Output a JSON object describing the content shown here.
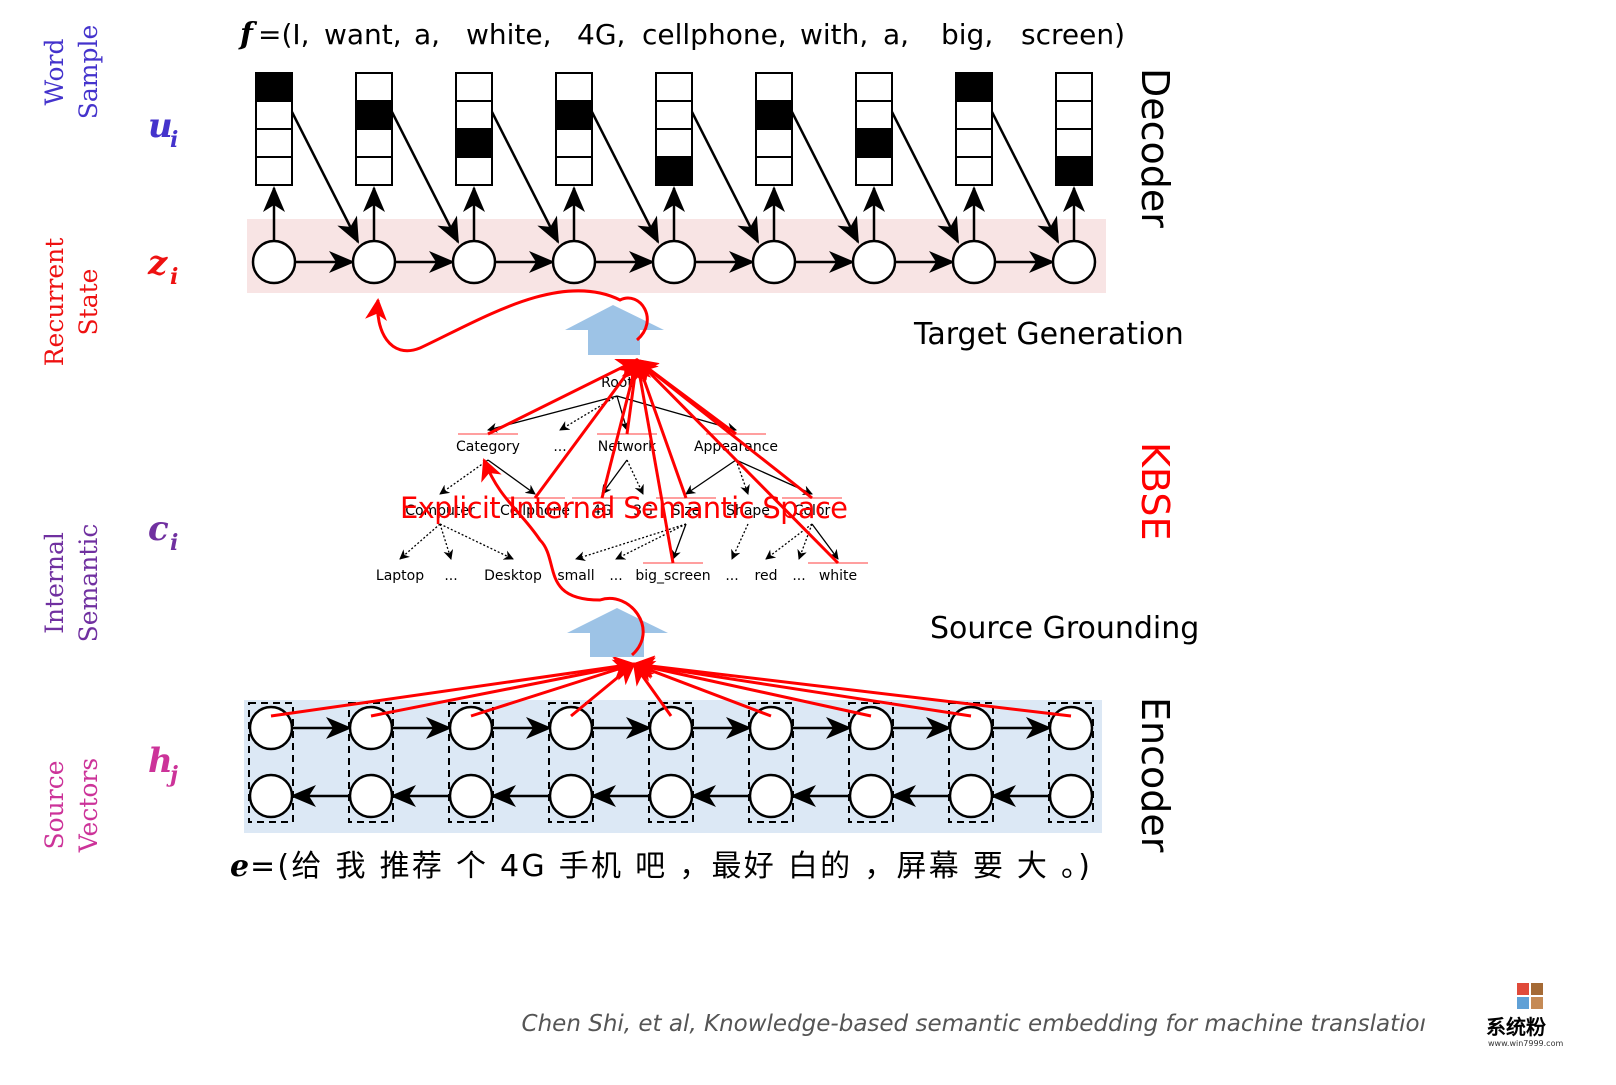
{
  "target_sentence": {
    "prefix": "f",
    "tokens": [
      "=(I,",
      "want,",
      "a,",
      "white,",
      "4G,",
      "cellphone,",
      "with,",
      "a,",
      "big,",
      "screen)"
    ]
  },
  "source_sentence": {
    "prefix": "e",
    "text": "=(给 我 推荐 个 4G 手机 吧 ，最好 白的 ，屏幕 要 大 。)"
  },
  "row_labels": [
    {
      "line1": "Word",
      "line2": "Sample",
      "symbol": "u",
      "sub": "i",
      "color": "#4433cc"
    },
    {
      "line1": "Recurrent",
      "line2": "State",
      "symbol": "z",
      "sub": "i",
      "color": "#ee1111"
    },
    {
      "line1": "Internal",
      "line2": "Semantic",
      "symbol": "c",
      "sub": "i",
      "color": "#7030a0"
    },
    {
      "line1": "Source",
      "line2": "Vectors",
      "symbol": "h",
      "sub": "j",
      "color": "#cc3399"
    }
  ],
  "side_labels": {
    "decoder": "Decoder",
    "kbse": "KBSE",
    "encoder": "Encoder"
  },
  "stage_labels": {
    "target_generation": "Target Generation",
    "source_grounding": "Source Grounding"
  },
  "kb_overlay": "Explicit Internal Semantic Space",
  "word_samples": [
    0,
    1,
    2,
    1,
    3,
    1,
    2,
    0,
    3
  ],
  "tree": {
    "root": "Root",
    "level1": [
      "Category",
      "...",
      "Network",
      "Appearance"
    ],
    "level2": [
      "Computer",
      "Cellphone",
      "4G",
      "3G",
      "Size",
      "Shape",
      "Color"
    ],
    "level3": [
      "Laptop",
      "...",
      "Desktop",
      "small",
      "...",
      "big_screen",
      "...",
      "red",
      "...",
      "white"
    ]
  },
  "citation": "Chen Shi, et al, Knowledge-based semantic embedding for machine translatioı",
  "watermark": {
    "text": "系统粉",
    "url_text": "www.win7999.com"
  },
  "colors": {
    "decoder_band": "#f8e4e4",
    "encoder_band": "#dce8f5",
    "attention": "#ff0000",
    "arrow_block": "#9dc3e6"
  }
}
